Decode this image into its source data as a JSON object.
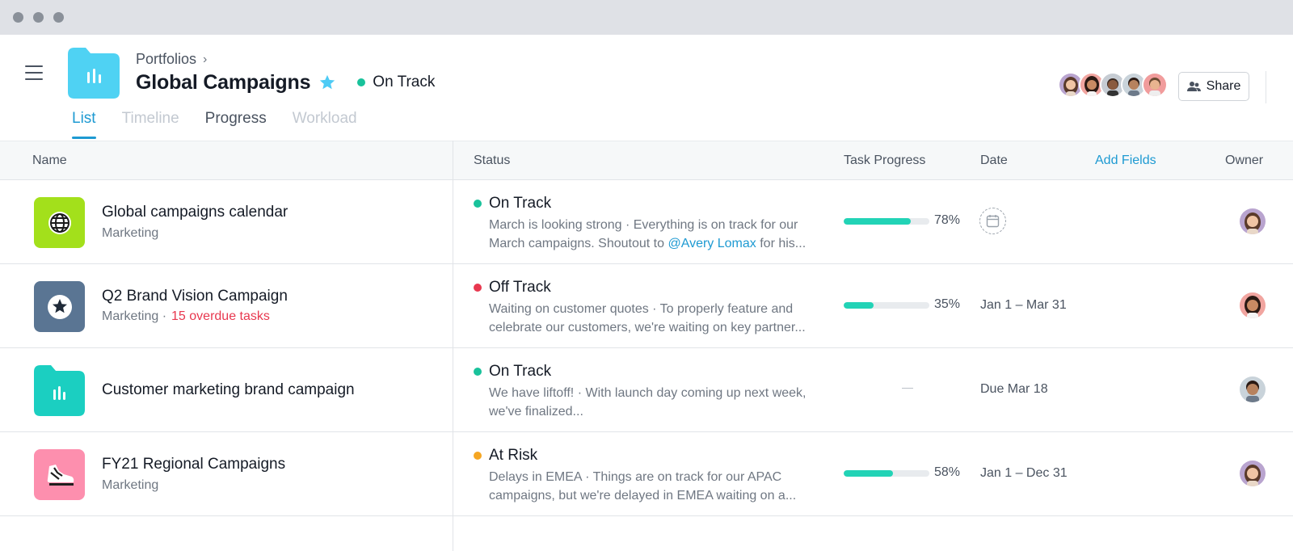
{
  "breadcrumb": {
    "label": "Portfolios"
  },
  "header": {
    "title": "Global Campaigns",
    "status": "On Track",
    "status_color": "#19c29b",
    "share_label": "Share",
    "star_color": "#4ecbf5"
  },
  "tabs": [
    {
      "label": "List",
      "state": "active"
    },
    {
      "label": "Timeline",
      "state": "disabled"
    },
    {
      "label": "Progress",
      "state": "normal"
    },
    {
      "label": "Workload",
      "state": "disabled"
    }
  ],
  "columns": {
    "name": "Name",
    "status": "Status",
    "progress": "Task Progress",
    "date": "Date",
    "add_fields": "Add Fields",
    "owner": "Owner"
  },
  "rows": [
    {
      "name": "Global campaigns calendar",
      "team": "Marketing",
      "overdue": "",
      "icon": "globe-icon",
      "icon_color": "#a3e01b",
      "status": "On Track",
      "status_color": "#19c29b",
      "desc_before": "March is looking strong · Everything is on track for our March campaigns. Shoutout to ",
      "mention": "@Avery Lomax",
      "desc_after": " for his...",
      "progress": 78,
      "progress_label": "78%",
      "date": ""
    },
    {
      "name": "Q2 Brand Vision Campaign",
      "team": "Marketing ·",
      "overdue": "15 overdue tasks",
      "icon": "star-icon",
      "icon_color": "#5a7593",
      "status": "Off Track",
      "status_color": "#e8384f",
      "desc_before": "Waiting on customer quotes · To properly feature and celebrate our customers, we're waiting on key partner...",
      "mention": "",
      "desc_after": "",
      "progress": 35,
      "progress_label": "35%",
      "date": "Jan 1 – Mar 31"
    },
    {
      "name": "Customer marketing brand campaign",
      "team": "",
      "overdue": "",
      "icon": "folder-chart-icon",
      "icon_color": "#1bcfc1",
      "status": "On Track",
      "status_color": "#19c29b",
      "desc_before": "We have liftoff! · With launch day coming up next week, we've finalized...",
      "mention": "",
      "desc_after": "",
      "progress_label": "—",
      "date": "Due Mar 18"
    },
    {
      "name": "FY21 Regional Campaigns",
      "team": "Marketing",
      "overdue": "",
      "icon": "sneaker-icon",
      "icon_color": "#fd8fae",
      "status": "At Risk",
      "status_color": "#f5a623",
      "desc_before": "Delays in EMEA · Things are on track for our APAC campaigns, but we're delayed in EMEA waiting on a...",
      "mention": "",
      "desc_after": "",
      "progress": 58,
      "progress_label": "58%",
      "date": "Jan 1 – Dec 31"
    }
  ]
}
